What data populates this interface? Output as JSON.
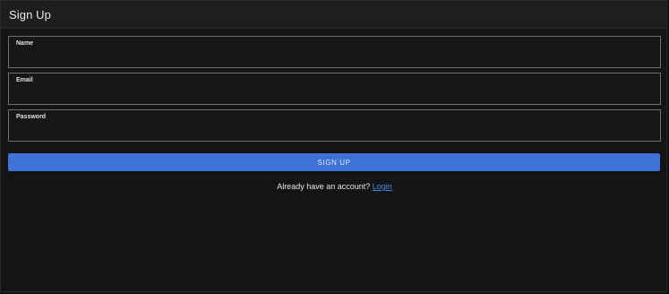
{
  "header": {
    "title": "Sign Up"
  },
  "form": {
    "fields": [
      {
        "label": "Name",
        "value": ""
      },
      {
        "label": "Email",
        "value": ""
      },
      {
        "label": "Password",
        "value": ""
      }
    ],
    "submit_label": "SIGN UP"
  },
  "footer": {
    "prompt": "Already have an account?",
    "link_label": "Login"
  },
  "colors": {
    "background": "#141414",
    "header": "#1e1e1e",
    "accent": "#3e73d8",
    "link": "#3e8ee8"
  }
}
